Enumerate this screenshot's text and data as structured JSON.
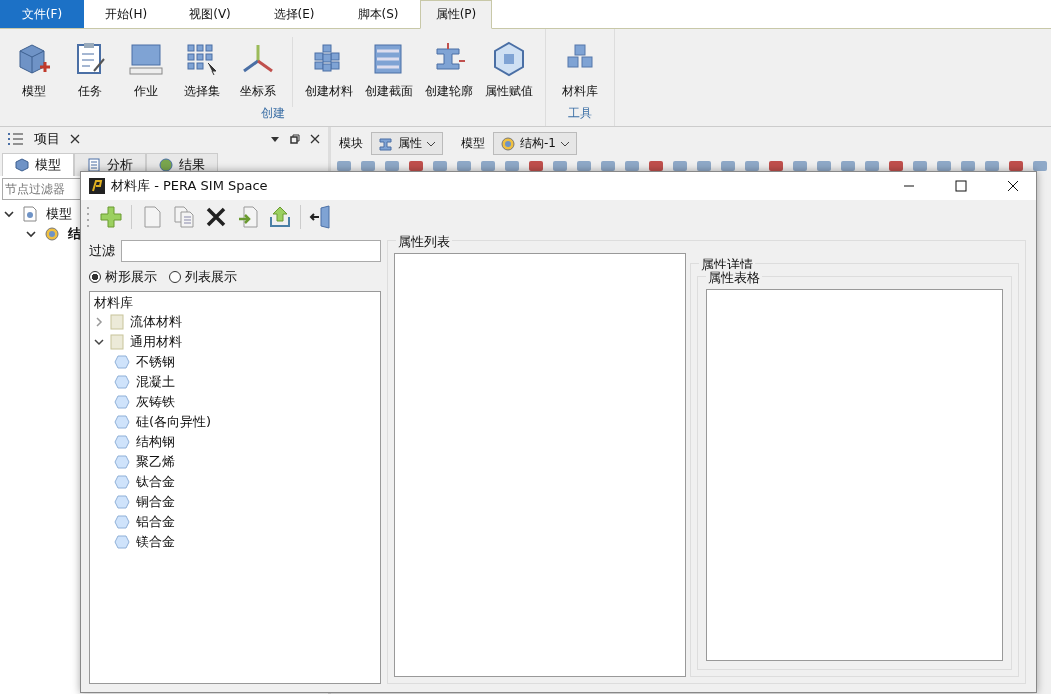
{
  "menu_tabs": [
    {
      "label": "文件(F)",
      "kind": "file",
      "selected": false
    },
    {
      "label": "开始(H)",
      "kind": "tab",
      "selected": false
    },
    {
      "label": "视图(V)",
      "kind": "tab",
      "selected": false
    },
    {
      "label": "选择(E)",
      "kind": "tab",
      "selected": false
    },
    {
      "label": "脚本(S)",
      "kind": "tab",
      "selected": false
    },
    {
      "label": "属性(P)",
      "kind": "tab",
      "selected": true
    }
  ],
  "ribbon_groups": [
    {
      "label": "创建",
      "sections": [
        [
          "模型",
          "任务",
          "作业",
          "选择集",
          "坐标系"
        ],
        [
          "创建材料",
          "创建截面",
          "创建轮廓",
          "属性赋值"
        ]
      ]
    },
    {
      "label": "工具",
      "sections": [
        [
          "材料库"
        ]
      ]
    }
  ],
  "project_panel": {
    "title": "项目",
    "tabs": [
      {
        "label": "模型",
        "selected": true
      },
      {
        "label": "分析",
        "selected": false
      },
      {
        "label": "结果",
        "selected": false
      }
    ],
    "filter": {
      "placeholder": "节点过滤器"
    },
    "tree": [
      {
        "label": "模型",
        "expanded": true,
        "children": [
          {
            "label": "结",
            "expanded": true
          }
        ]
      }
    ]
  },
  "view_toolbar": {
    "module_label": "模块",
    "module_value": "属性",
    "model_label": "模型",
    "model_value": "结构-1"
  },
  "dialog": {
    "title": "材料库 - PERA SIM Space",
    "filter_label": "过滤",
    "view_options": [
      {
        "label": "树形展示",
        "selected": true
      },
      {
        "label": "列表展示",
        "selected": false
      }
    ],
    "tree_root": "材料库",
    "tree": [
      {
        "label": "流体材料",
        "kind": "folder",
        "expanded": false
      },
      {
        "label": "通用材料",
        "kind": "folder",
        "expanded": true,
        "children": [
          {
            "label": "不锈钢",
            "kind": "material"
          },
          {
            "label": "混凝土",
            "kind": "material"
          },
          {
            "label": "灰铸铁",
            "kind": "material"
          },
          {
            "label": "硅(各向异性)",
            "kind": "material"
          },
          {
            "label": "结构钢",
            "kind": "material"
          },
          {
            "label": "聚乙烯",
            "kind": "material"
          },
          {
            "label": "钛合金",
            "kind": "material"
          },
          {
            "label": "铜合金",
            "kind": "material"
          },
          {
            "label": "铝合金",
            "kind": "material"
          },
          {
            "label": "镁合金",
            "kind": "material"
          }
        ]
      }
    ],
    "property_list_title": "属性列表",
    "property_details_title": "属性详情",
    "property_table_title": "属性表格"
  }
}
